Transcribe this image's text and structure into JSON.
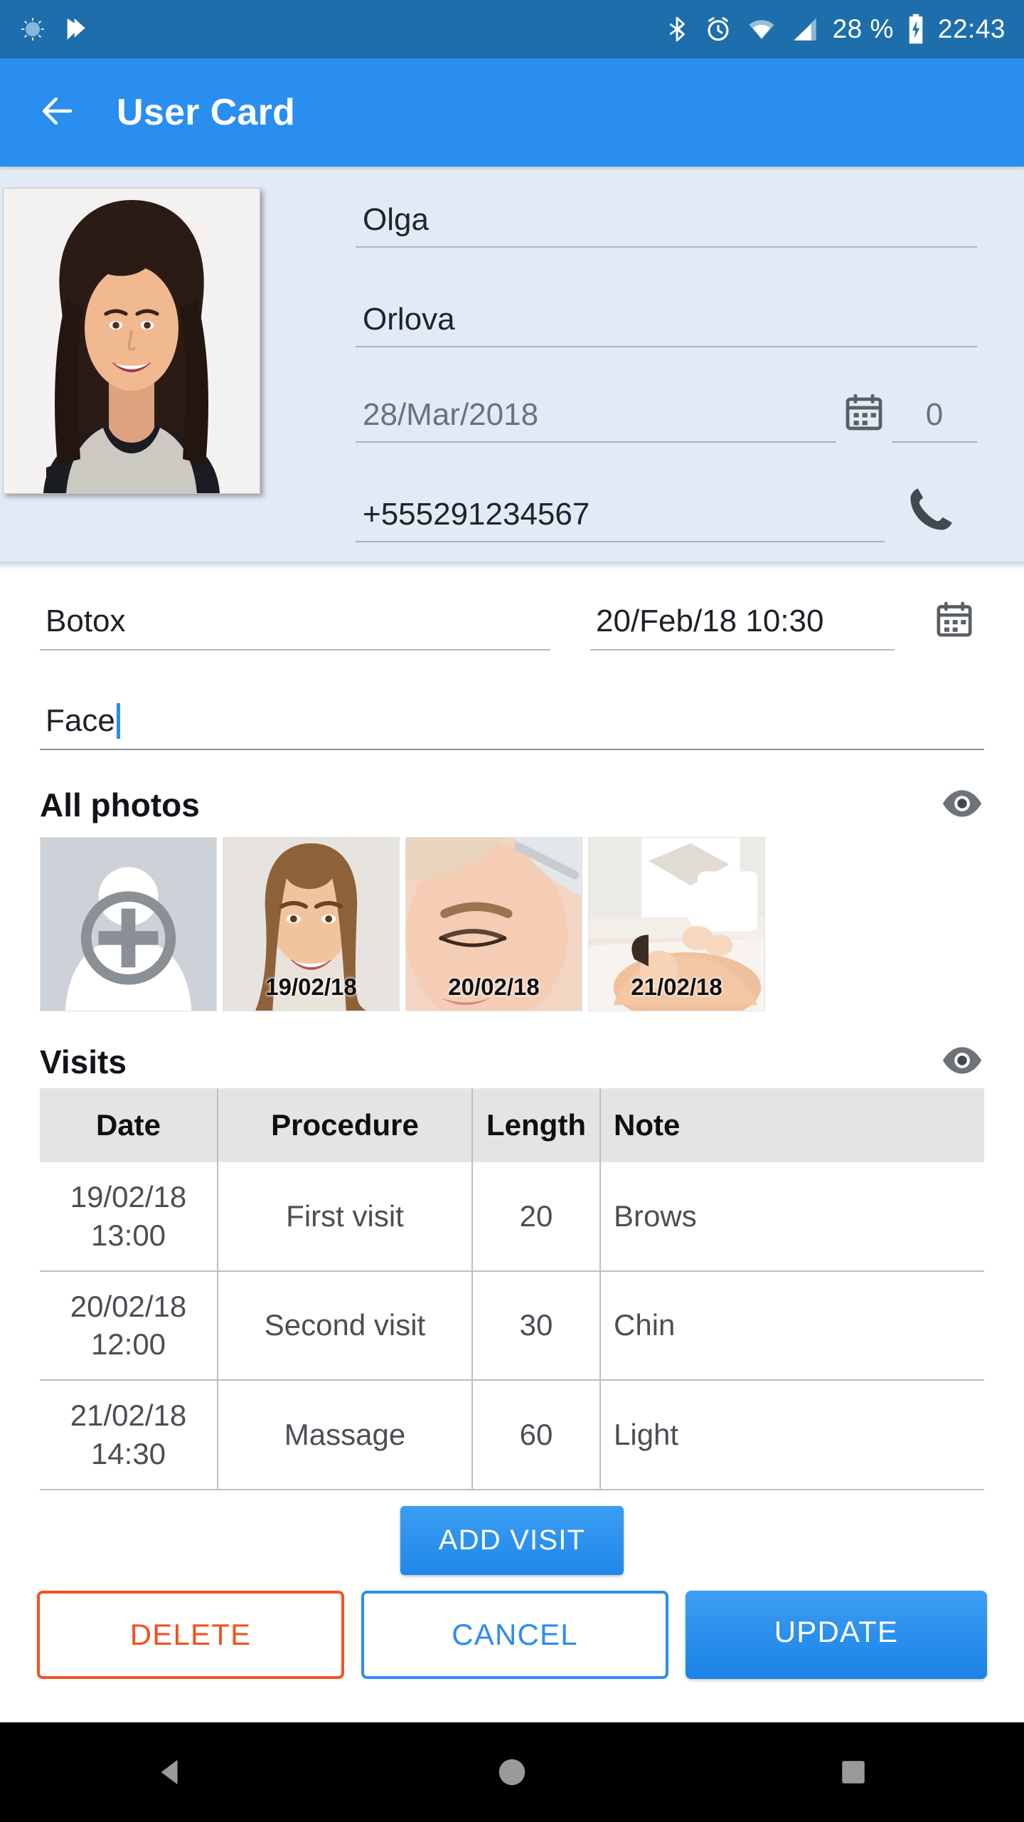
{
  "statusbar": {
    "battery_percent": "28 %",
    "time": "22:43",
    "icons": [
      "brightness-icon",
      "checkmark-flag-icon",
      "bluetooth-icon",
      "alarm-icon",
      "wifi-icon",
      "signal-icon",
      "battery-charging-icon"
    ]
  },
  "appbar": {
    "back_label": "back-arrow",
    "title": "User Card"
  },
  "profile": {
    "avatar_alt": "user-photo",
    "first_name": "Olga",
    "last_name": "Orlova",
    "birth_date": "28/Mar/2018",
    "counter": "0",
    "phone": "+555291234567",
    "calendar_icon": "calendar-icon",
    "phone_icon": "phone-icon"
  },
  "procedure": {
    "name": "Botox",
    "datetime": "20/Feb/18 10:30",
    "note": "Face",
    "calendar_icon": "calendar-icon"
  },
  "photos": {
    "title": "All photos",
    "eye_icon": "eye-icon",
    "items": [
      {
        "label": "",
        "kind": "add-photo-placeholder"
      },
      {
        "label": "19/02/18",
        "kind": "photo-smiling-woman"
      },
      {
        "label": "20/02/18",
        "kind": "photo-brow-treatment"
      },
      {
        "label": "21/02/18",
        "kind": "photo-massage"
      }
    ]
  },
  "visits": {
    "title": "Visits",
    "eye_icon": "eye-icon",
    "columns": [
      "Date",
      "Procedure",
      "Length",
      "Note"
    ],
    "rows": [
      {
        "date": "19/02/18",
        "time": "13:00",
        "procedure": "First visit",
        "length": "20",
        "note": "Brows"
      },
      {
        "date": "20/02/18",
        "time": "12:00",
        "procedure": "Second visit",
        "length": "30",
        "note": "Chin"
      },
      {
        "date": "21/02/18",
        "time": "14:30",
        "procedure": "Massage",
        "length": "60",
        "note": "Light"
      }
    ]
  },
  "actions": {
    "add_visit": "ADD VISIT",
    "delete": "DELETE",
    "cancel": "CANCEL",
    "update": "UPDATE"
  },
  "navbar": {
    "back": "triangle-back-icon",
    "home": "circle-home-icon",
    "recents": "square-recents-icon"
  },
  "colors": {
    "status_bar": "#1d6eab",
    "app_bar": "#2a8df0",
    "accent_blue": "#2a8df0",
    "danger_orange": "#f4511e",
    "panel_bg": "#e2ebf5"
  }
}
